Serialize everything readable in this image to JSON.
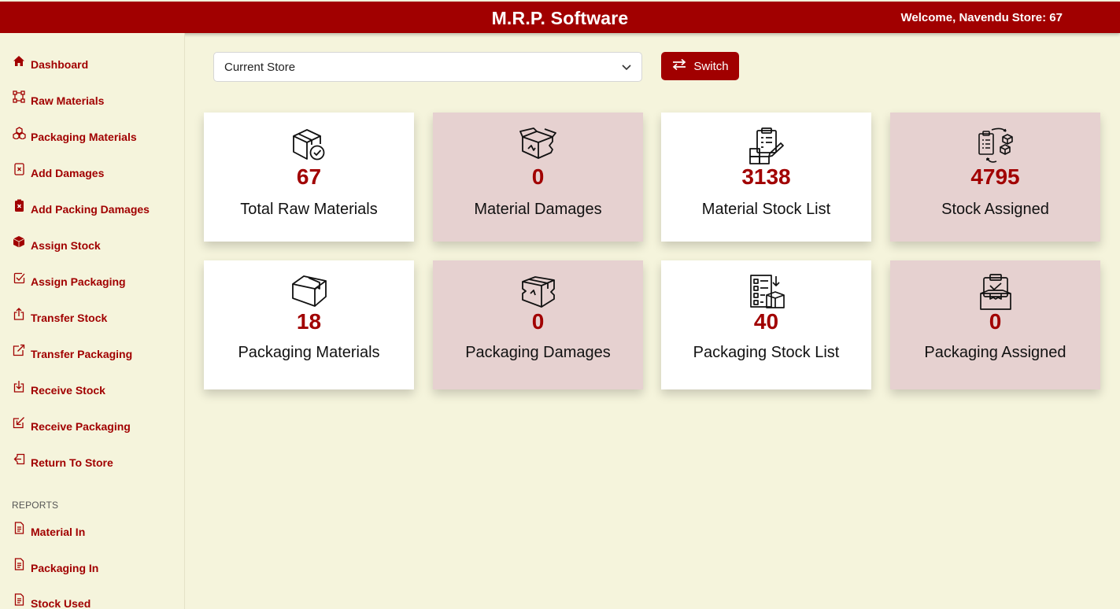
{
  "header": {
    "title": "M.R.P. Software",
    "welcome": "Welcome, Navendu",
    "store": "Store: 67",
    "accent_color": "#a10000"
  },
  "sidebar": {
    "items": [
      {
        "label": "Dashboard",
        "icon": "home-icon"
      },
      {
        "label": "Raw Materials",
        "icon": "nodes-icon"
      },
      {
        "label": "Packaging Materials",
        "icon": "boxes-icon"
      },
      {
        "label": "Add Damages",
        "icon": "file-x-icon"
      },
      {
        "label": "Add Packing Damages",
        "icon": "clipboard-x-icon"
      },
      {
        "label": "Assign Stock",
        "icon": "box-icon"
      },
      {
        "label": "Assign Packaging",
        "icon": "check-square-icon"
      },
      {
        "label": "Transfer Stock",
        "icon": "box-arrow-up-icon"
      },
      {
        "label": "Transfer Packaging",
        "icon": "box-arrow-up-right-icon"
      },
      {
        "label": "Receive Stock",
        "icon": "box-arrow-in-down-icon"
      },
      {
        "label": "Receive Packaging",
        "icon": "box-arrow-in-down-left-icon"
      },
      {
        "label": "Return To Store",
        "icon": "box-arrow-in-left-icon"
      }
    ],
    "reports_heading": "REPORTS",
    "reports": [
      {
        "label": "Material In",
        "icon": "file-text-icon"
      },
      {
        "label": "Packaging In",
        "icon": "file-text-icon"
      },
      {
        "label": "Stock Used",
        "icon": "file-text-icon"
      }
    ]
  },
  "toolbar": {
    "store_select_value": "Current Store",
    "switch_label": "Switch"
  },
  "cards": [
    {
      "value": "67",
      "label": "Total Raw Materials",
      "icon": "box-check-icon",
      "style": "white"
    },
    {
      "value": "0",
      "label": "Material Damages",
      "icon": "damaged-box-icon",
      "style": "pink"
    },
    {
      "value": "3138",
      "label": "Material Stock List",
      "icon": "clipboard-boxes-icon",
      "style": "white"
    },
    {
      "value": "4795",
      "label": "Stock Assigned",
      "icon": "clipboard-cycle-icon",
      "style": "pink"
    },
    {
      "value": "18",
      "label": "Packaging Materials",
      "icon": "package-icon",
      "style": "white"
    },
    {
      "value": "0",
      "label": "Packaging Damages",
      "icon": "broken-package-icon",
      "style": "pink"
    },
    {
      "value": "40",
      "label": "Packaging Stock List",
      "icon": "checklist-box-icon",
      "style": "white"
    },
    {
      "value": "0",
      "label": "Packaging Assigned",
      "icon": "clipboard-box-icon",
      "style": "pink"
    }
  ]
}
